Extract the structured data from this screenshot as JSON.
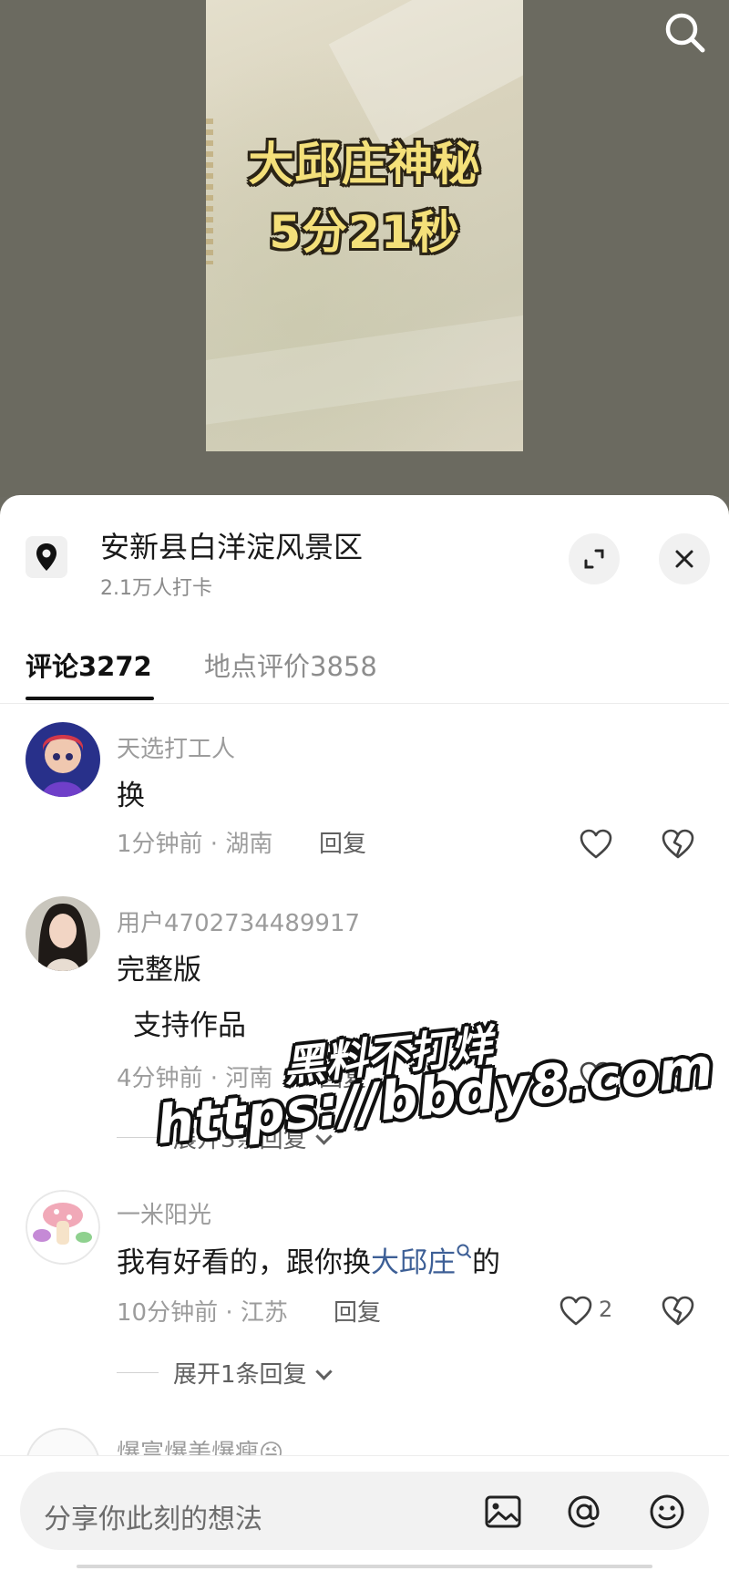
{
  "video": {
    "poster_title_line1": "大邱庄神秘",
    "poster_title_line2": "5分21秒",
    "search_icon": "search-icon"
  },
  "location": {
    "icon": "location-pin-icon",
    "name": "安新县白洋淀风景区",
    "checkins": "2.1万人打卡"
  },
  "tabs": [
    {
      "label": "评论3272",
      "active": true
    },
    {
      "label": "地点评价3858",
      "active": false
    }
  ],
  "comments": [
    {
      "username": "天选打工人",
      "text_lines": [
        "换"
      ],
      "meta": "1分钟前 · 湖南",
      "reply_label": "回复",
      "likes": ""
    },
    {
      "username": "用户4702734489917",
      "text_lines": [
        "完整版",
        " 支持作品"
      ],
      "meta": "4分钟前 · 河南",
      "reply_label": "回复",
      "expand_label": "展开3条回复",
      "likes": ""
    },
    {
      "username": "一米阳光",
      "text_prefix": "我有好看的，跟你换",
      "text_link": "大邱庄",
      "text_suffix": "的",
      "meta": "10分钟前 · 江苏",
      "reply_label": "回复",
      "likes": "2",
      "expand_label": "展开1条回复"
    },
    {
      "username": "爆富爆美爆瘦😜"
    }
  ],
  "watermark": {
    "line1": "黑料不打烊",
    "line2": "https://bbdy8.com"
  },
  "input": {
    "placeholder": "分享你此刻的想法",
    "icons": [
      "image-icon",
      "at-icon",
      "emoji-icon"
    ]
  },
  "colors": {
    "link": "#3d5f96",
    "text": "#1a1a1a",
    "muted": "#9c9c9c",
    "poster_text": "#f4e07a"
  }
}
